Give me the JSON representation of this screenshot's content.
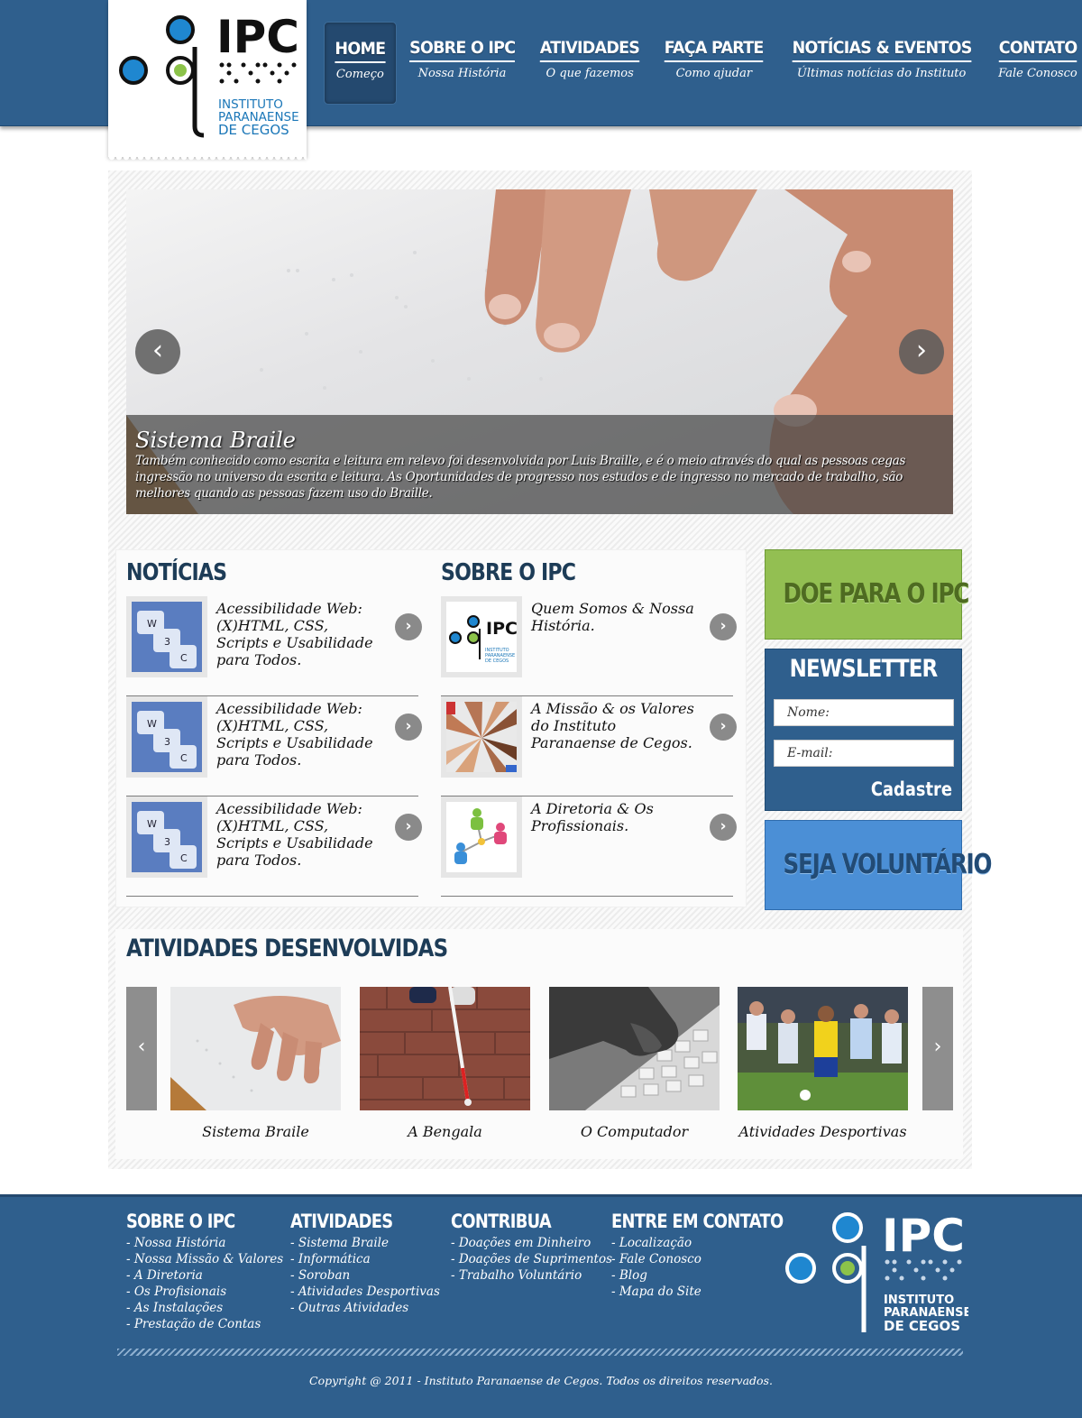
{
  "header": {
    "logo": {
      "title": "IPC",
      "line1": "INSTITUTO",
      "line2": "PARANAENSE",
      "line3": "DE CEGOS"
    },
    "nav": [
      {
        "label": "HOME",
        "sub": "Começo",
        "active": true
      },
      {
        "label": "SOBRE O IPC",
        "sub": "Nossa História"
      },
      {
        "label": "ATIVIDADES",
        "sub": "O que fazemos"
      },
      {
        "label": "FAÇA PARTE",
        "sub": "Como ajudar"
      },
      {
        "label": "NOTÍCIAS & EVENTOS",
        "sub": "Últimas notícias do Instituto"
      },
      {
        "label": "CONTATO",
        "sub": "Fale Conosco"
      }
    ]
  },
  "slider": {
    "title": "Sistema Braile",
    "text": "Também conhecido como escrita e leitura em relevo foi desenvolvida por Luis Braille, e é o meio através do qual as pessoas cegas ingressão no universo da  escrita e leitura. As Oportunidades de progresso nos estudos e de ingresso no mercado de trabalho, são melhores quando as pessoas fazem uso do Braille.",
    "prev_icon": "chevron-left-icon",
    "next_icon": "chevron-right-icon"
  },
  "news": {
    "title": "NOTÍCIAS",
    "items": [
      {
        "text": "Acessibilidade Web: (X)HTML, CSS, Scripts e Usabilidade para Todos."
      },
      {
        "text": "Acessibilidade Web: (X)HTML, CSS, Scripts e Usabilidade para Todos."
      },
      {
        "text": "Acessibilidade Web: (X)HTML, CSS, Scripts e Usabilidade para Todos."
      }
    ]
  },
  "about": {
    "title": "SOBRE O IPC",
    "items": [
      {
        "text": "Quem Somos & Nossa História."
      },
      {
        "text": "A Missão & os Valores do Instituto Paranaense de Cegos."
      },
      {
        "text": "A Diretoria & Os Profissionais."
      }
    ],
    "thumb_logo": {
      "title": "IPC",
      "line1": "INSTITUTO",
      "line2": "PARANAENSE",
      "line3": "DE CEGOS"
    }
  },
  "sidebar": {
    "donate": "DOE PARA O IPC",
    "newsletter": {
      "title": "NEWSLETTER",
      "name_placeholder": "Nome:",
      "email_placeholder": "E-mail:",
      "submit": "Cadastre"
    },
    "volunteer": "SEJA VOLUNTÁRIO"
  },
  "activities": {
    "title": "ATIVIDADES DESENVOLVIDAS",
    "items": [
      {
        "label": "Sistema Braile"
      },
      {
        "label": "A Bengala"
      },
      {
        "label": "O Computador"
      },
      {
        "label": "Atividades Desportivas"
      }
    ]
  },
  "footer": {
    "columns": [
      {
        "title": "SOBRE O IPC",
        "links": [
          "- Nossa História",
          "- Nossa Missão & Valores",
          "- A Diretoria",
          "- Os Profisionais",
          "- As Instalações",
          "- Prestação de Contas"
        ]
      },
      {
        "title": "ATIVIDADES",
        "links": [
          "- Sistema Braile",
          "- Informática",
          "- Soroban",
          "- Atividades Desportivas",
          "- Outras Atividades"
        ]
      },
      {
        "title": "CONTRIBUA",
        "links": [
          "- Doações em Dinheiro",
          "- Doações de Suprimentos",
          "- Trabalho Voluntário"
        ]
      },
      {
        "title": "ENTRE EM CONTATO",
        "links": [
          "- Localização",
          "- Fale Conosco",
          "- Blog",
          "- Mapa do Site"
        ]
      }
    ],
    "logo": {
      "title": "IPC",
      "line1": "INSTITUTO",
      "line2": "PARANAENSE",
      "line3": "DE CEGOS"
    },
    "copyright": "Copyright @ 2011 - Instituto Paranaense de Cegos. Todos os direitos reservados."
  },
  "colors": {
    "primary": "#2f5f8d",
    "donate": "#93bf52",
    "volunteer": "#4b8fd6",
    "heading": "#1d3c57"
  }
}
